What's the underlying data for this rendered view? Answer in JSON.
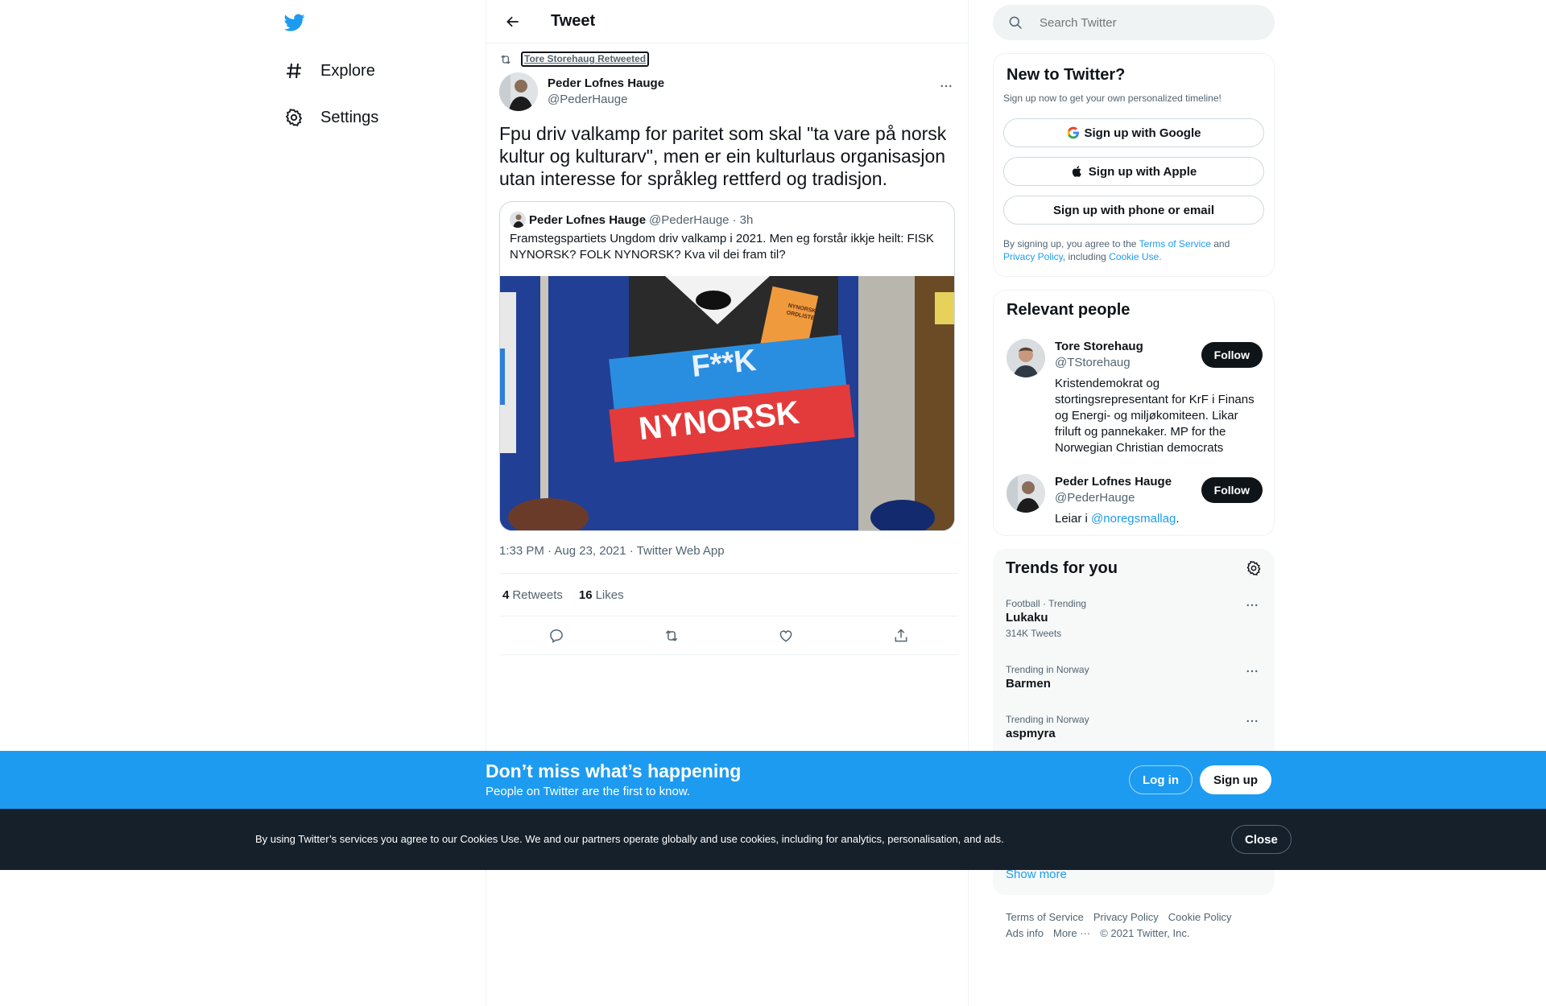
{
  "nav": {
    "explore_label": "Explore",
    "settings_label": "Settings"
  },
  "header": {
    "title": "Tweet"
  },
  "tweet": {
    "social_context": "Tore Storehaug Retweeted",
    "author_name": "Peder Lofnes Hauge",
    "author_handle": "@PederHauge",
    "text": "Fpu driv valkamp for paritet som skal \"ta vare på norsk kultur og kulturarv\", men er ein kulturlaus organisasjon utan interesse for språkleg rettferd og tradisjon.",
    "quote": {
      "author_name": "Peder Lofnes Hauge",
      "author_handle": "@PederHauge",
      "time": "· 3h",
      "text": "Framstegspartiets Ungdom driv valkamp i 2021. Men eg forstår ikkje heilt: FISK NYNORSK? FOLK NYNORSK? Kva vil dei fram til?",
      "image_text_top": "F**K",
      "image_text_bottom": "NYNORSK",
      "image_book_text": "NYNORSK ORDLISTE"
    },
    "meta": "1:33 PM · Aug 23, 2021 · Twitter Web App",
    "retweets_count": "4",
    "retweets_label": "Retweets",
    "likes_count": "16",
    "likes_label": "Likes"
  },
  "search": {
    "placeholder": "Search Twitter"
  },
  "new_to_twitter": {
    "title": "New to Twitter?",
    "subtitle": "Sign up now to get your own personalized timeline!",
    "google_label": "Sign up with Google",
    "apple_label": "Sign up with Apple",
    "phone_label": "Sign up with phone or email",
    "legal_1": "By signing up, you agree to the ",
    "terms": "Terms of Service",
    "legal_2": " and ",
    "privacy": "Privacy Policy",
    "legal_3": ", including ",
    "cookie": "Cookie Use."
  },
  "relevant_people": {
    "title": "Relevant people",
    "people": [
      {
        "name": "Tore Storehaug",
        "handle": "@TStorehaug",
        "bio": "Kristendemokrat og stortingsrepresentant for KrF i Finans og Energi- og miljøkomiteen. Likar friluft og pannekaker. MP for the Norwegian Christian democrats",
        "follow_label": "Follow"
      },
      {
        "name": "Peder Lofnes Hauge",
        "handle": "@PederHauge",
        "bio_prefix": "Leiar i ",
        "bio_link": "@noregsmallag",
        "bio_suffix": ".",
        "follow_label": "Follow"
      }
    ]
  },
  "trends": {
    "title": "Trends for you",
    "items": [
      {
        "meta": "Football · Trending",
        "name": "Lukaku",
        "count": "314K Tweets"
      },
      {
        "meta": "Trending in Norway",
        "name": "Barmen"
      },
      {
        "meta": "Trending in Norway",
        "name": "aspmyra"
      }
    ],
    "show_more": "Show more"
  },
  "footer": {
    "terms": "Terms of Service",
    "privacy": "Privacy Policy",
    "cookie": "Cookie Policy",
    "ads": "Ads info",
    "more": "More ···",
    "copyright": "© 2021 Twitter, Inc."
  },
  "bottom_bar": {
    "title": "Don’t miss what’s happening",
    "subtitle": "People on Twitter are the first to know.",
    "login_label": "Log in",
    "signup_label": "Sign up"
  },
  "cookie_bar": {
    "text": "By using Twitter’s services you agree to our Cookies Use. We and our partners operate globally and use cookies, including for analytics, personalisation, and ads.",
    "close_label": "Close"
  },
  "colors": {
    "accent": "#1d9bf0",
    "text": "#0f1419",
    "muted": "#536471",
    "cookie_bg": "#15202b"
  }
}
